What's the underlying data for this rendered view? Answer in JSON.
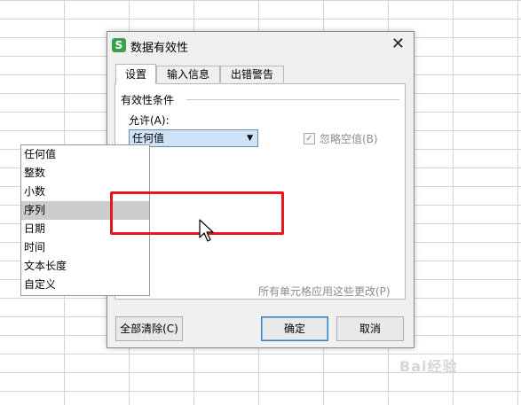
{
  "dialog": {
    "app_icon_letter": "S",
    "title": "数据有效性",
    "close_glyph": "✕",
    "tabs": [
      {
        "label": "设置",
        "active": true
      },
      {
        "label": "输入信息",
        "active": false
      },
      {
        "label": "出错警告",
        "active": false
      }
    ],
    "group_title": "有效性条件",
    "allow_label": "允许(A):",
    "allow_select": {
      "value": "任何值",
      "arrow": "▼"
    },
    "ignore_blank": {
      "label": "忽略空值(B)",
      "checked": true,
      "check_glyph": "✓"
    },
    "apply_all_label": "所有单元格应用这些更改(P)",
    "dropdown_options": [
      {
        "label": "任何值",
        "highlighted": false
      },
      {
        "label": "整数",
        "highlighted": false
      },
      {
        "label": "小数",
        "highlighted": false
      },
      {
        "label": "序列",
        "highlighted": true
      },
      {
        "label": "日期",
        "highlighted": false
      },
      {
        "label": "时间",
        "highlighted": false
      },
      {
        "label": "文本长度",
        "highlighted": false
      },
      {
        "label": "自定义",
        "highlighted": false
      }
    ],
    "buttons": {
      "clear_all": "全部清除(C)",
      "ok": "确定",
      "cancel": "取消"
    }
  },
  "annotation": {
    "color": "#e8171b"
  },
  "watermark": "Bai经验",
  "colors": {
    "select_bg": "#cfe3f7",
    "highlight_bg": "#cccccc",
    "app_icon": "#3aa04b"
  }
}
